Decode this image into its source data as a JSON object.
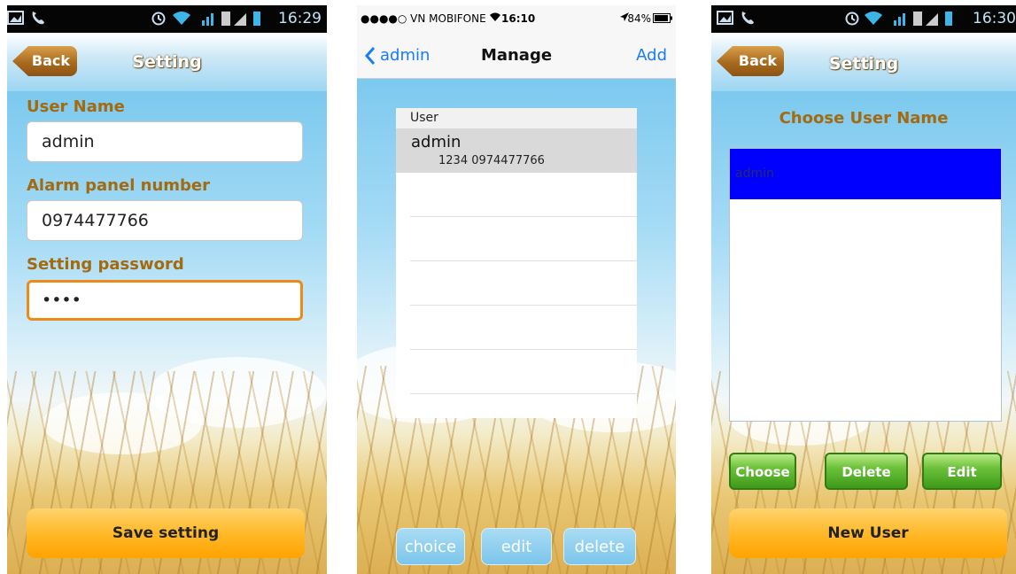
{
  "screen1": {
    "status_time": "16:29",
    "back_label": "Back",
    "title": "Setting",
    "user_name_label": "User Name",
    "user_name_value": "admin",
    "alarm_label": "Alarm panel number",
    "alarm_value": "0974477766",
    "password_label": "Setting password",
    "password_value": "••••",
    "save_label": "Save setting"
  },
  "screen2": {
    "carrier": "●●●●○ VN MOBIFONE",
    "time": "16:10",
    "battery": "84%",
    "back_label": "admin",
    "title": "Manage",
    "add_label": "Add",
    "list_header": "User",
    "user_name": "admin",
    "user_detail": "1234  0974477766",
    "buttons": [
      "choice",
      "edit",
      "delete"
    ]
  },
  "screen3": {
    "status_time": "16:30",
    "back_label": "Back",
    "title": "Setting",
    "choose_title": "Choose User Name",
    "selected_user": "admin",
    "buttons": [
      "Choose",
      "Delete",
      "Edit"
    ],
    "new_user_label": "New User"
  }
}
